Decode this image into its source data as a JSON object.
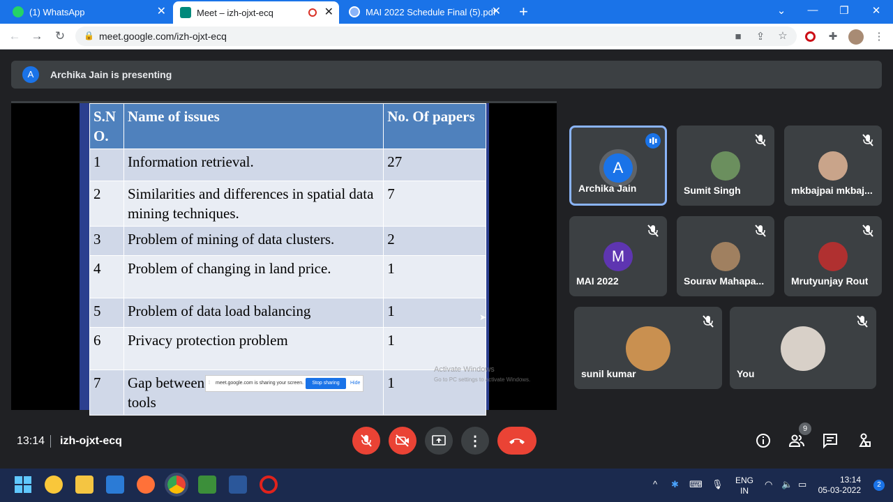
{
  "browser": {
    "tabs": [
      {
        "label": "(1) WhatsApp",
        "icon": "whatsapp-icon"
      },
      {
        "label": "Meet – izh-ojxt-ecq",
        "icon": "google-meet-icon"
      },
      {
        "label": "MAI 2022 Schedule Final (5).pdf",
        "icon": "pdf-globe-icon"
      }
    ],
    "url": "meet.google.com/izh-ojxt-ecq"
  },
  "meet": {
    "presenting_initial": "A",
    "presenting_text": "Archika Jain is presenting",
    "slide": {
      "headers": [
        "S.N O.",
        "Name of issues",
        "No. Of papers"
      ],
      "rows": [
        {
          "sno": "1",
          "issue": "Information retrieval.",
          "papers": "27"
        },
        {
          "sno": "2",
          "issue": "Similarities and differences in spatial data mining techniques.",
          "papers": "7"
        },
        {
          "sno": "3",
          "issue": "Problem of mining of data clusters.",
          "papers": "2"
        },
        {
          "sno": "4",
          "issue": "Problem of changing in land price.",
          "papers": "1"
        },
        {
          "sno": "5",
          "issue": "Problem of  data load balancing",
          "papers": "1"
        },
        {
          "sno": "6",
          "issue": "Privacy protection problem",
          "papers": "1"
        },
        {
          "sno": "7",
          "issue": "Gap between",
          "issue2": "tools",
          "papers": "1"
        }
      ],
      "share_bar": {
        "text": "meet.google.com is sharing your screen.",
        "stop": "Stop sharing",
        "hide": "Hide"
      },
      "watermark": "Activate Windows",
      "watermark_sub": "Go to PC settings to activate Windows."
    },
    "participants": [
      {
        "name": "Archika Jain",
        "initial": "A",
        "color": "#1a73e8"
      },
      {
        "name": "Sumit Singh",
        "initial": "",
        "color": "#6b8f5e"
      },
      {
        "name": "mkbajpai mkbaj...",
        "initial": "",
        "color": "#c9a48a"
      },
      {
        "name": "MAI 2022",
        "initial": "M",
        "color": "#5e35b1"
      },
      {
        "name": "Sourav Mahapa...",
        "initial": "",
        "color": "#a08060"
      },
      {
        "name": "Mrutyunjay Rout",
        "initial": "",
        "color": "#b03030"
      },
      {
        "name": "sunil kumar",
        "initial": "",
        "color": "#c99050"
      },
      {
        "name": "You",
        "initial": "",
        "color": "#d8d0c8"
      }
    ],
    "time": "13:14",
    "meeting_code": "izh-ojxt-ecq",
    "people_count": "9"
  },
  "taskbar": {
    "lang1": "ENG",
    "lang2": "IN",
    "clock_time": "13:14",
    "clock_date": "05-03-2022",
    "notifications": "2"
  }
}
